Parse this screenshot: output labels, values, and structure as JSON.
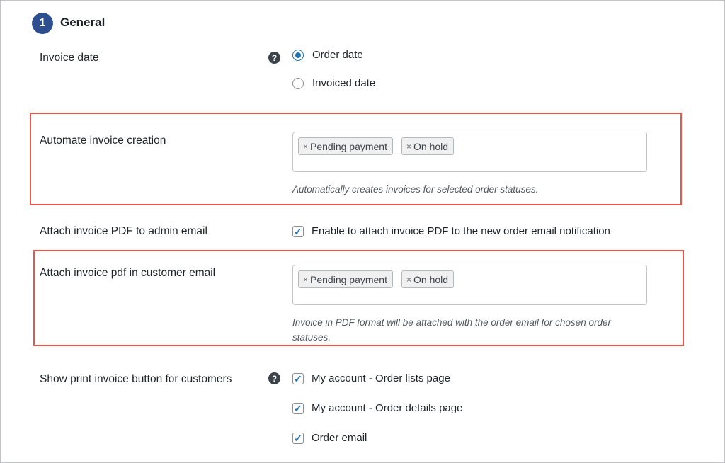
{
  "section": {
    "number": "1",
    "title": "General"
  },
  "invoice_date": {
    "label": "Invoice date",
    "help": "?",
    "options": [
      {
        "label": "Order date",
        "checked": true
      },
      {
        "label": "Invoiced date",
        "checked": false
      }
    ]
  },
  "automate": {
    "label": "Automate invoice creation",
    "tags": [
      "Pending payment",
      "On hold"
    ],
    "tag_remove": "×",
    "description": "Automatically creates invoices for selected order statuses."
  },
  "attach_admin": {
    "label": "Attach invoice PDF to admin email",
    "checkbox_label": "Enable to attach invoice PDF to the new order email notification",
    "checked": true
  },
  "attach_customer": {
    "label": "Attach invoice pdf in customer email",
    "tags": [
      "Pending payment",
      "On hold"
    ],
    "tag_remove": "×",
    "description_line1": "Invoice in PDF format will be attached with the order email for chosen order",
    "description_line2": "statuses."
  },
  "print_button": {
    "label": "Show print invoice button for customers",
    "help": "?",
    "options": [
      {
        "label": "My account - Order lists page",
        "checked": true
      },
      {
        "label": "My account - Order details page",
        "checked": true
      },
      {
        "label": "Order email",
        "checked": true
      }
    ]
  },
  "check_glyph": "✓",
  "colors": {
    "accent": "#2271b1",
    "badge": "#2d4f8f",
    "highlight": "#e9574a"
  }
}
